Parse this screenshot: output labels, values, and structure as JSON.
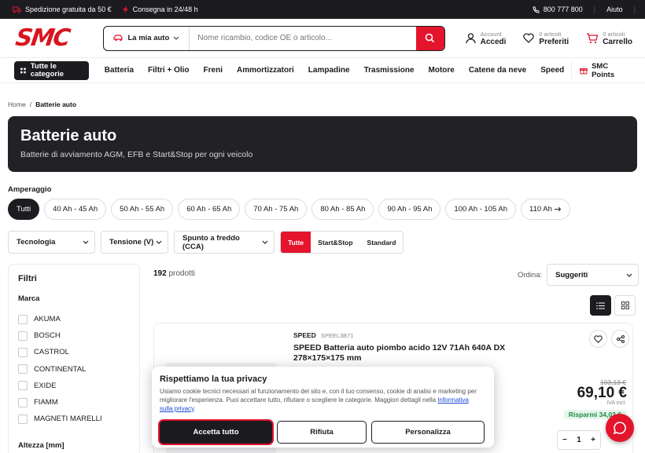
{
  "topbar": {
    "shipping": "Spedizione gratuita da 50 €",
    "delivery": "Consegna in 24/48 h",
    "phone": "800 777 800",
    "help": "Aiuto"
  },
  "header": {
    "logo": "SMC",
    "car_selector": "La mia auto",
    "search_placeholder": "Nome ricambio, codice OE o articolo...",
    "account_small": "Account",
    "account_big": "Accedi",
    "fav_small": "0 articoli",
    "fav_big": "Preferiti",
    "cart_small": "0 articoli",
    "cart_big": "Carrello"
  },
  "nav": {
    "all_categories": "Tutte le categorie",
    "items": [
      "Batteria",
      "Filtri + Olio",
      "Freni",
      "Ammortizzatori",
      "Lampadine",
      "Trasmissione",
      "Motore",
      "Catene da neve",
      "Speed"
    ],
    "points": "SMC Points"
  },
  "breadcrumb": {
    "home": "Home",
    "current": "Batterie auto"
  },
  "hero": {
    "title": "Batterie auto",
    "subtitle": "Batterie di avviamento AGM, EFB e Start&Stop per ogni veicolo"
  },
  "amperage": {
    "label": "Amperaggio",
    "chips": [
      "Tutti",
      "40 Ah - 45 Ah",
      "50 Ah - 55 Ah",
      "60 Ah - 65 Ah",
      "70 Ah - 75 Ah",
      "80 Ah - 85 Ah",
      "90 Ah - 95 Ah",
      "100 Ah - 105 Ah",
      "110 Ah"
    ]
  },
  "filters": {
    "tech": "Tecnologia",
    "voltage": "Tensione (V)",
    "cca": "Spunto a freddo (CCA)",
    "seg": [
      "Tutte",
      "Start&Stop",
      "Standard"
    ]
  },
  "sidebar": {
    "title": "Filtri",
    "brand_heading": "Marca",
    "brands": [
      "AKUMA",
      "BOSCH",
      "CASTROL",
      "CONTINENTAL",
      "EXIDE",
      "FIAMM",
      "MAGNETI MARELLI"
    ],
    "height_heading": "Altezza [mm]"
  },
  "results": {
    "count": "192",
    "count_label": "prodotti",
    "order_label": "Ordina:",
    "order_value": "Suggeriti"
  },
  "product": {
    "brand": "SPEED",
    "sku": "SPEEL3B71",
    "title": "SPEED Batteria auto piombo acido 12V 71Ah 640A DX 278×175×175 mm",
    "old_price": "103,13 €",
    "price": "69,10 €",
    "vat": "IVA incl.",
    "savings": "Risparmi 34,03 €",
    "qty": "1"
  },
  "cookie": {
    "title": "Rispettiamo la tua privacy",
    "body": "Usiamo cookie tecnici necessari al funzionamento del sito e, con il tuo consenso, cookie di analisi e marketing per migliorare l'esperienza. Puoi accettare tutto, rifiutare o scegliere le categorie. Maggiori dettagli nella",
    "link": "Informativa sulla privacy",
    "accept": "Accetta tutto",
    "reject": "Rifiuta",
    "customize": "Personalizza"
  }
}
